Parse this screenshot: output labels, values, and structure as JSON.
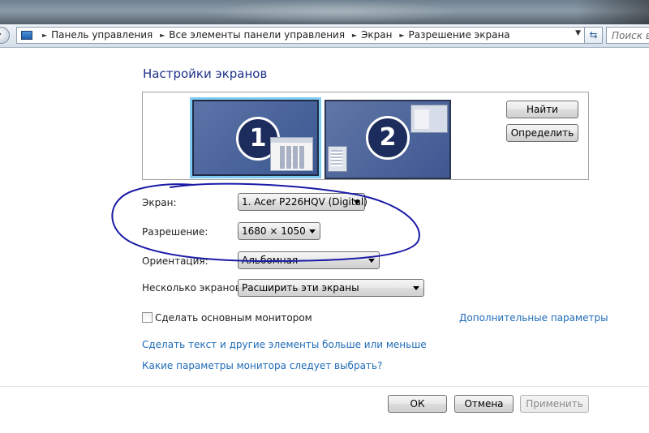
{
  "breadcrumb": {
    "items": [
      "Панель управления",
      "Все элементы панели управления",
      "Экран",
      "Разрешение экрана"
    ]
  },
  "search": {
    "placeholder": "Поиск в п"
  },
  "page": {
    "title": "Настройки экранов"
  },
  "monitors": {
    "one": "1",
    "two": "2"
  },
  "buttons": {
    "identify": "Найти",
    "detect": "Определить",
    "ok": "ОК",
    "cancel": "Отмена",
    "apply": "Применить"
  },
  "settings": {
    "display_label": "Экран:",
    "display_value": "1. Acer P226HQV (Digital)",
    "resolution_label": "Разрешение:",
    "resolution_value": "1680 × 1050",
    "orientation_label": "Ориентация:",
    "orientation_value": "Альбомная",
    "multi_label": "Несколько экранов:",
    "multi_value": "Расширить эти экраны"
  },
  "primary_checkbox": {
    "label": "Сделать основным монитором",
    "checked": false
  },
  "links": {
    "advanced": "Дополнительные параметры",
    "text_size": "Сделать текст и другие элементы больше или меньше",
    "which_settings": "Какие параметры монитора следует выбрать?"
  },
  "annotation": {
    "color": "#1a1aa6"
  }
}
